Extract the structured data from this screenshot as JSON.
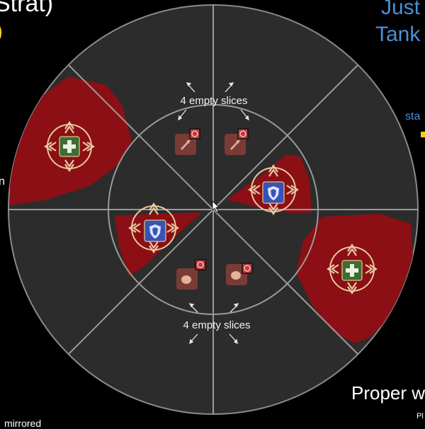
{
  "overlay": {
    "top_left_text": "Strat)",
    "top_left_marker": ")",
    "top_right_line1": "Just",
    "top_right_line2": "Tank",
    "right_small_text": "sta",
    "left_mid_text": "n",
    "bottom_right_text": "Proper w",
    "bottom_right_small": "Pl",
    "bottom_left_text": "mirrored"
  },
  "arena": {
    "top_slices_label": "4 empty slices",
    "bottom_slices_label": "4 empty slices"
  },
  "colors": {
    "background": "#000000",
    "arena_fill": "#2c2c2c",
    "divider": "#9a9a9a",
    "danger_zone": "#8b0f14",
    "accent_text": "#4a8fd6",
    "yellow_marker": "#f2d21b",
    "healer_icon": "#3f6b34",
    "tank_icon": "#3952b8",
    "dps_marker": "#7a3b36"
  },
  "icons": {
    "healer": "healer-cross-icon",
    "tank": "tank-shield-icon",
    "ranged_dps": "ranged-dps-icon",
    "melee_dps": "melee-dps-icon",
    "target": "target-circle-icon"
  }
}
